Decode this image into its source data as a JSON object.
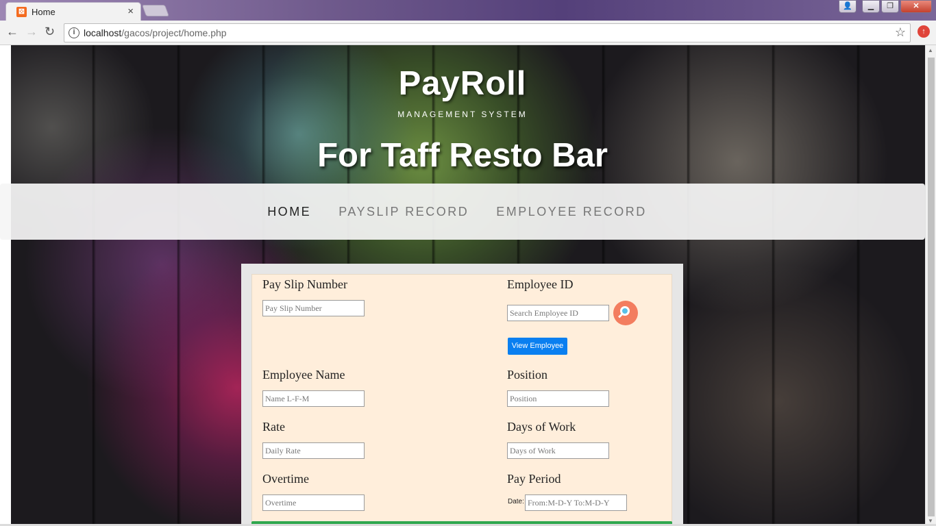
{
  "browser": {
    "tab_title": "Home",
    "tab_close": "×",
    "url_host": "localhost",
    "url_path": "/gacos/project/home.php"
  },
  "header": {
    "title": "PayRoll",
    "subtitle": "MANAGEMENT SYSTEM",
    "tagline": "For Taff Resto Bar"
  },
  "nav": {
    "items": [
      {
        "label": "HOME",
        "active": true
      },
      {
        "label": "PAYSLIP RECORD",
        "active": false
      },
      {
        "label": "EMPLOYEE RECORD",
        "active": false
      }
    ]
  },
  "form": {
    "payslip_number": {
      "label": "Pay Slip Number",
      "placeholder": "Pay Slip Number"
    },
    "employee_id": {
      "label": "Employee ID",
      "placeholder": "Search Employee ID"
    },
    "view_employee_label": "View Employee",
    "employee_name": {
      "label": "Employee Name",
      "placeholder": "Name L-F-M"
    },
    "position": {
      "label": "Position",
      "placeholder": "Position"
    },
    "rate": {
      "label": "Rate",
      "placeholder": "Daily Rate"
    },
    "days_of_work": {
      "label": "Days of Work",
      "placeholder": "Days of Work"
    },
    "overtime": {
      "label": "Overtime",
      "placeholder": "Overtime"
    },
    "pay_period": {
      "label": "Pay Period",
      "date_label": "Date:",
      "placeholder": "From:M-D-Y To:M-D-Y"
    }
  },
  "colors": {
    "card_bg": "#ffeedb",
    "primary_button": "#0a7ff0",
    "search_button": "#f37d5f",
    "submit_bar": "#2fa84f"
  }
}
